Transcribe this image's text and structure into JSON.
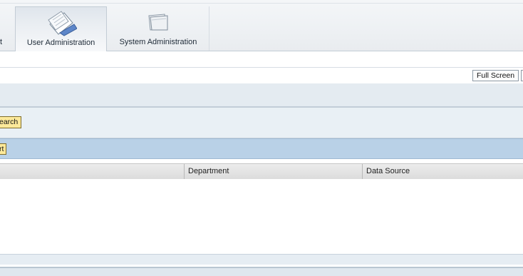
{
  "nav": {
    "tabs": [
      {
        "label": "t",
        "icon": "truncated-tab"
      },
      {
        "label": "User Administration",
        "icon": "papers-icon",
        "active": true
      },
      {
        "label": "System Administration",
        "icon": "folder-icon",
        "active": false
      }
    ]
  },
  "toolbar": {
    "full_screen_label": "Full Screen"
  },
  "search": {
    "button_label": "earch"
  },
  "results": {
    "export_label": "rt",
    "columns": [
      "",
      "Department",
      "Data Source"
    ],
    "rows": []
  },
  "colors": {
    "accent_button": "#fce99a",
    "header_band": "#b9d1e7",
    "panel_band": "#e9f0f5"
  }
}
